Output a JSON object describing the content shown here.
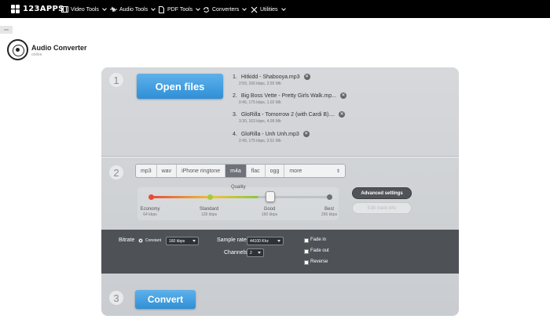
{
  "brand": {
    "name": "123APPS"
  },
  "nav": [
    {
      "label": "Video Tools",
      "icon": "video-icon"
    },
    {
      "label": "Audio Tools",
      "icon": "audio-wave-icon"
    },
    {
      "label": "PDF Tools",
      "icon": "document-icon"
    },
    {
      "label": "Converters",
      "icon": "convert-arrows-icon"
    },
    {
      "label": "Utilities",
      "icon": "tools-icon"
    }
  ],
  "app": {
    "title": "Audio Converter",
    "subtitle": "online"
  },
  "steps": {
    "one": "1",
    "two": "2",
    "three": "3"
  },
  "open_button": "Open files",
  "files": [
    {
      "index": "1.",
      "name": "Hitkidd - Shabooya.mp3",
      "meta": "2:59, 166 kbps, 3.55 Mb"
    },
    {
      "index": "2.",
      "name": "Big Boss Vette - Pretty Girls Walk.mp...",
      "meta": "0:46, 175 kbps, 1.02 Mb"
    },
    {
      "index": "3.",
      "name": "GloRilla - Tomorrow 2 (with Cardi B)....",
      "meta": "3:30, 163 kbps, 4.09 Mb"
    },
    {
      "index": "4.",
      "name": "GloRilla - Unh Unh.mp3",
      "meta": "2:49, 175 kbps, 3.51 Mb"
    }
  ],
  "formats": [
    "mp3",
    "wav",
    "iPhone ringtone",
    "m4a",
    "flac",
    "ogg",
    "more"
  ],
  "selected_format": "m4a",
  "quality": {
    "label": "Quality",
    "selected_index": 2,
    "levels": [
      {
        "name": "Economy",
        "bitrate": "64 kbps"
      },
      {
        "name": "Standard",
        "bitrate": "128 kbps"
      },
      {
        "name": "Good",
        "bitrate": "160 kbps"
      },
      {
        "name": "Best",
        "bitrate": "256 kbps"
      }
    ]
  },
  "advanced_button": "Advanced settings",
  "edit_button": "Edit track info",
  "settings": {
    "bitrate_label": "Bitrate",
    "bitrate_mode": "Constant",
    "bitrate_value": "160 kbps",
    "sample_rate_label": "Sample rate",
    "sample_rate_value": "44100 Khz",
    "channels_label": "Channels",
    "channels_value": "2",
    "fade_in": "Fade in",
    "fade_out": "Fade out",
    "reverse": "Reverse"
  },
  "convert_button": "Convert",
  "colors": {
    "accent_blue": "#2f8fd6",
    "slider_economy": "#e64b3c",
    "slider_standard": "#8cc63f",
    "dark_band": "#4e5257"
  }
}
